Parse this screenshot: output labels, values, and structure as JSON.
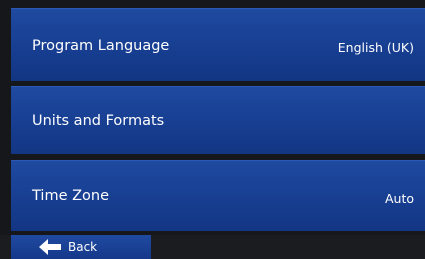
{
  "settings": {
    "items": [
      {
        "label": "Program Language",
        "value": "English (UK)"
      },
      {
        "label": "Units and Formats",
        "value": ""
      },
      {
        "label": "Time Zone",
        "value": "Auto"
      }
    ]
  },
  "footer": {
    "back_label": "Back",
    "back_icon": "left-arrow-icon"
  },
  "colors": {
    "row_blue": "#173e91",
    "background": "#15171b",
    "text": "#ffffff"
  }
}
